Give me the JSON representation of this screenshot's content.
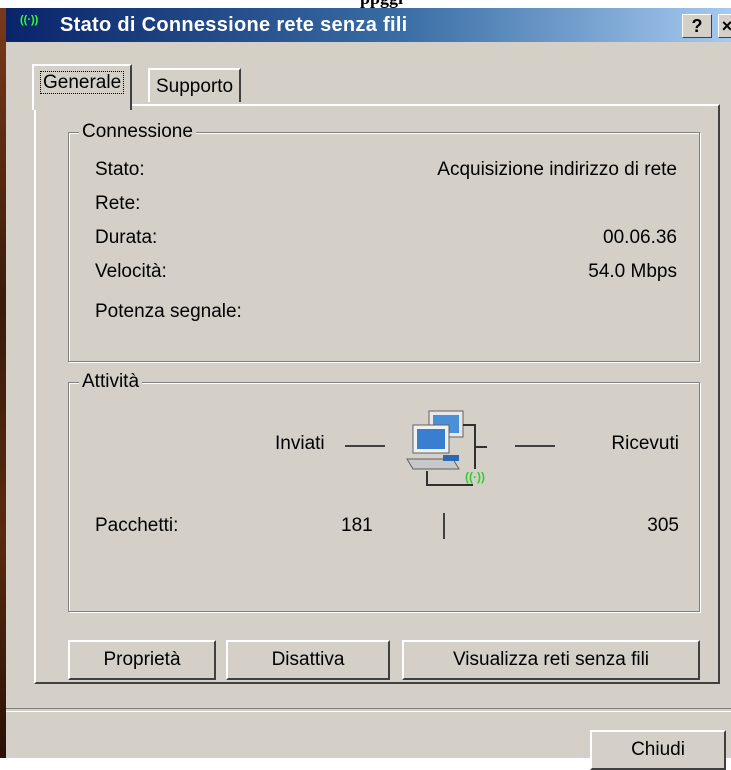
{
  "window": {
    "title": "Stato di Connessione rete senza fili",
    "help_button": "?",
    "close_button": "×"
  },
  "tabs": [
    {
      "label": "Generale",
      "active": true
    },
    {
      "label": "Supporto",
      "active": false
    }
  ],
  "connection": {
    "legend": "Connessione",
    "rows": [
      {
        "label": "Stato:",
        "value": "Acquisizione indirizzo di rete"
      },
      {
        "label": "Rete:",
        "value": ""
      },
      {
        "label": "Durata:",
        "value": "00.06.36"
      },
      {
        "label": "Velocità:",
        "value": "54.0 Mbps"
      },
      {
        "label": "Potenza segnale:",
        "value": ""
      }
    ]
  },
  "activity": {
    "legend": "Attività",
    "sent_label": "Inviati",
    "received_label": "Ricevuti",
    "packets_label": "Pacchetti:",
    "packets_sent": "181",
    "packets_received": "305",
    "icon": "network-computers-icon"
  },
  "buttons": {
    "properties": "Proprietà",
    "disable": "Disattiva",
    "view_networks": "Visualizza reti senza fili",
    "close": "Chiudi"
  },
  "colors": {
    "titlebar_start": "#0a246a",
    "titlebar_end": "#a6caf0",
    "face": "#d4d0c8",
    "wireless_green": "#33cc33"
  }
}
